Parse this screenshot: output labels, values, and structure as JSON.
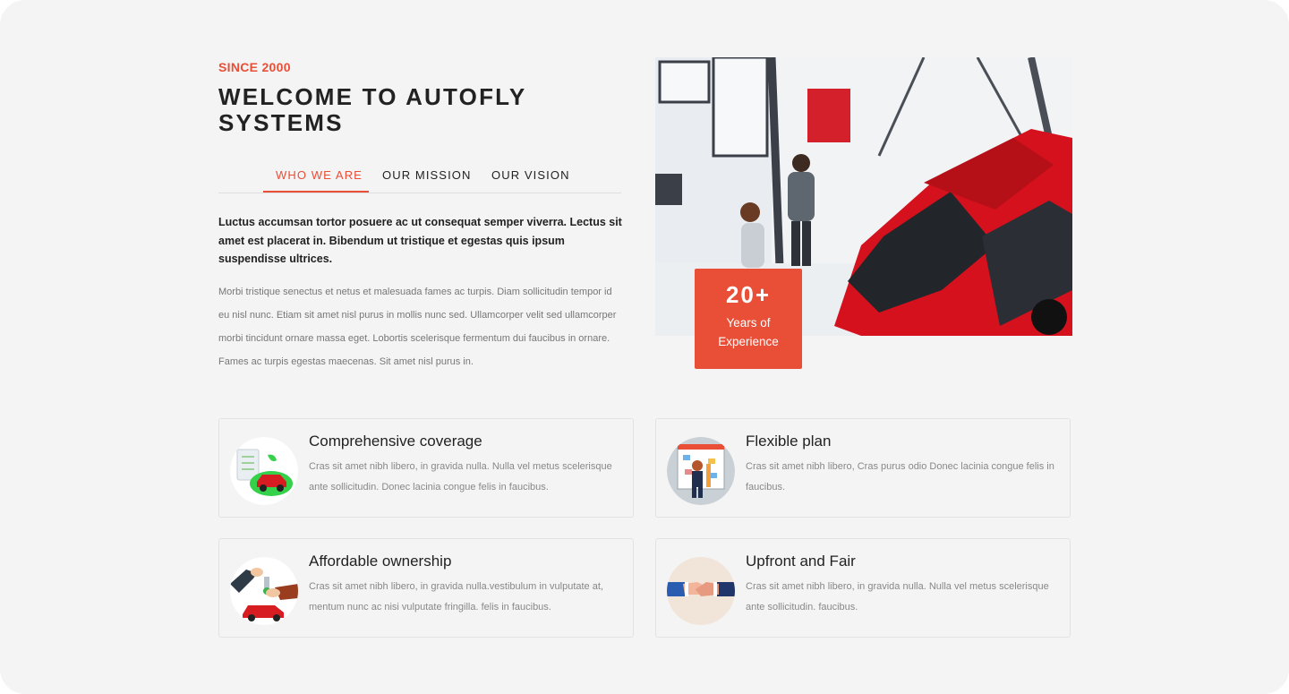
{
  "intro": {
    "eyebrow": "SINCE 2000",
    "title": "WELCOME TO AUTOFLY SYSTEMS"
  },
  "tabs": [
    {
      "label": "WHO WE ARE",
      "active": true
    },
    {
      "label": "OUR MISSION",
      "active": false
    },
    {
      "label": "OUR VISION",
      "active": false
    }
  ],
  "content": {
    "lead": "Luctus accumsan tortor posuere ac ut consequat semper viverra. Lectus sit amet est placerat in. Bibendum ut tristique et egestas quis ipsum suspendisse ultrices.",
    "body": "Morbi tristique senectus et netus et malesuada fames ac turpis. Diam sollicitudin tempor id eu nisl nunc. Etiam sit amet nisl purus in mollis nunc sed. Ullamcorper velit sed ullamcorper morbi tincidunt ornare massa eget. Lobortis scelerisque fermentum dui faucibus in ornare. Fames ac turpis egestas maecenas. Sit amet nisl purus in."
  },
  "hero": {
    "icon": "car-showroom-photo",
    "badge": {
      "number": "20+",
      "label": "Years of Experience"
    }
  },
  "features": [
    {
      "title": "Comprehensive coverage",
      "description": "Cras sit amet nibh libero, in gravida nulla. Nulla vel metus scelerisque ante sollicitudin. Donec lacinia congue felis in faucibus.",
      "icon": "car-insurance-icon"
    },
    {
      "title": "Flexible plan",
      "description": "Cras sit amet nibh libero, Cras purus odio Donec lacinia congue felis in faucibus.",
      "icon": "planning-board-icon"
    },
    {
      "title": "Affordable ownership",
      "description": "Cras sit amet nibh libero, in gravida nulla.vestibulum in vulputate at, mentum nunc ac nisi vulputate fringilla. felis in faucibus.",
      "icon": "car-key-handover-icon"
    },
    {
      "title": "Upfront and Fair",
      "description": "Cras sit amet nibh libero, in gravida nulla. Nulla vel metus scelerisque ante sollicitudin. faucibus.",
      "icon": "handshake-icon"
    }
  ],
  "colors": {
    "accent": "#e94e37",
    "background": "#f4f4f4",
    "heading": "#222222",
    "muted": "#777777"
  }
}
